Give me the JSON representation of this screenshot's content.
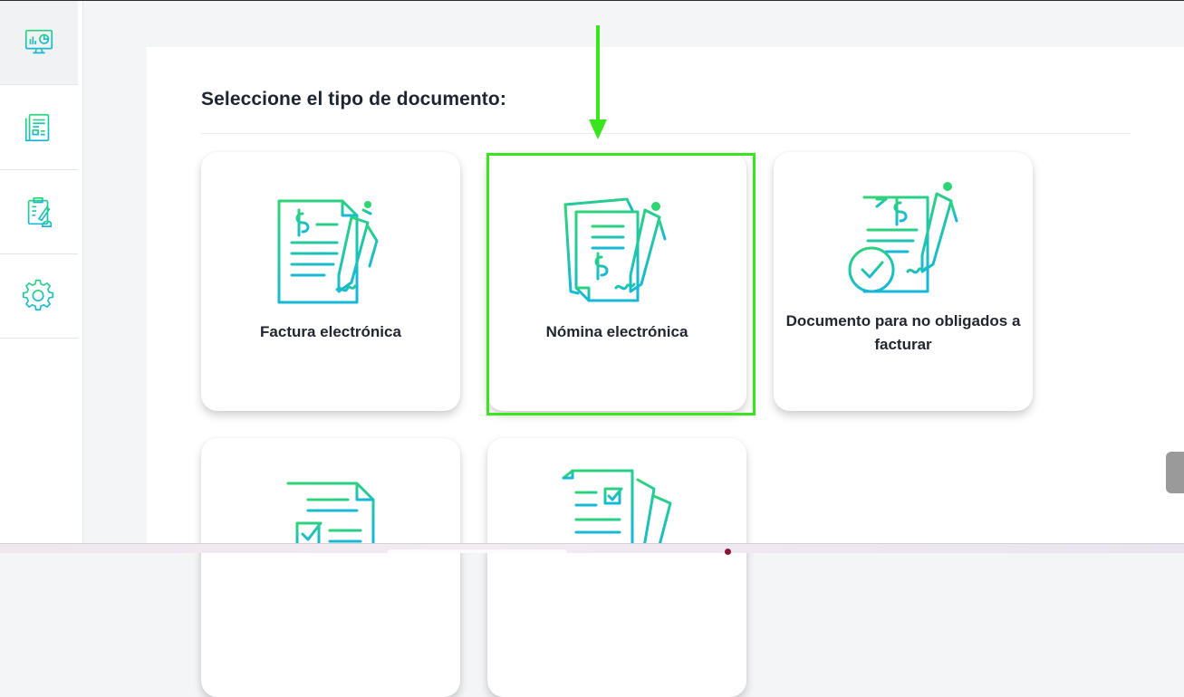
{
  "panel": {
    "title": "Seleccione el tipo de documento:"
  },
  "sidebar": {
    "items": [
      {
        "icon": "dashboard-monitor-icon",
        "active": true
      },
      {
        "icon": "documents-list-icon",
        "active": false
      },
      {
        "icon": "reports-clipboard-icon",
        "active": false
      },
      {
        "icon": "gear-icon",
        "active": false
      }
    ]
  },
  "cards": [
    {
      "label": "Factura electrónica",
      "icon": "invoice-signature-icon"
    },
    {
      "label": "Nómina electrónica",
      "icon": "payroll-documents-icon",
      "highlighted": true
    },
    {
      "label": "Documento para no obligados a facturar",
      "icon": "signed-document-check-icon"
    },
    {
      "icon": "document-checkbox-icon"
    },
    {
      "icon": "stacked-documents-check-icon"
    }
  ],
  "colors": {
    "accent_green": "#2ed573",
    "accent_teal": "#17b8d6",
    "highlight": "#39e51d",
    "title": "#1f2433"
  }
}
